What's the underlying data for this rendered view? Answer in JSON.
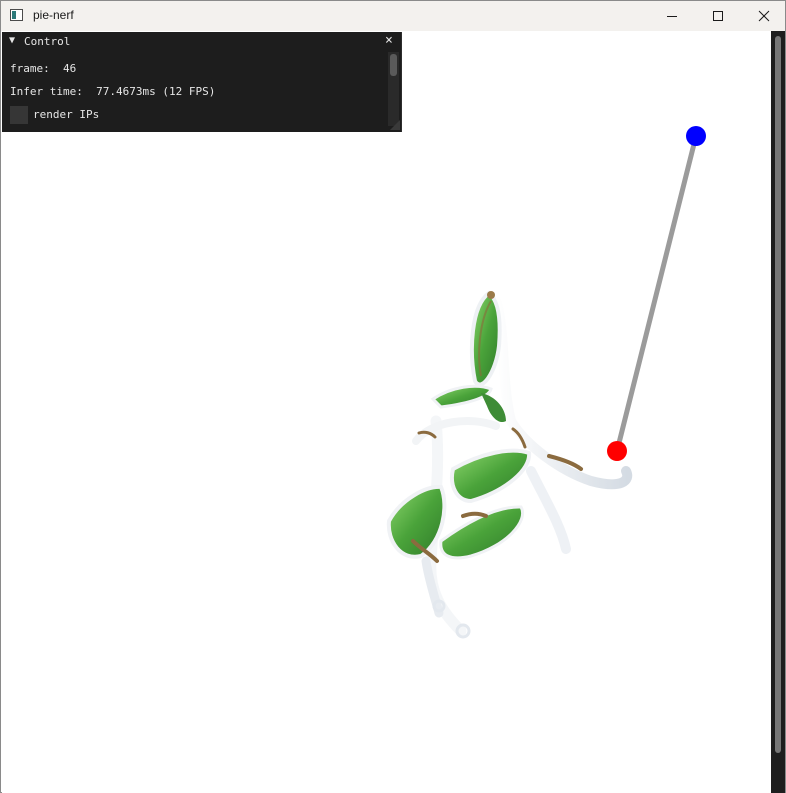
{
  "window": {
    "title": "pie-nerf",
    "icon": "app-window-icon",
    "controls": [
      "minimize-icon",
      "maximize-icon",
      "close-icon"
    ]
  },
  "panel": {
    "title": "Control",
    "collapse_icon": "triangle-down-icon",
    "close_symbol": "×",
    "frame_label": "frame:",
    "frame_value": "46",
    "infer_label": "Infer time:",
    "infer_value": "77.4673ms (12 FPS)",
    "render_ips_label": "render IPs",
    "render_ips_checked": false
  },
  "viewport": {
    "content": "rendered 3D chair with interaction handle",
    "handle_start_color": "#ff0000",
    "handle_end_color": "#0000ff",
    "handle_line_color": "#9b9b9b",
    "fabric_color": "#5fb04a",
    "frame_color": "#f2f2f2"
  },
  "colors": {
    "titlebar_bg": "#f3f1ee",
    "panel_bg": "#1d1d1d",
    "scrollbar_bg": "#1e1e1e"
  }
}
